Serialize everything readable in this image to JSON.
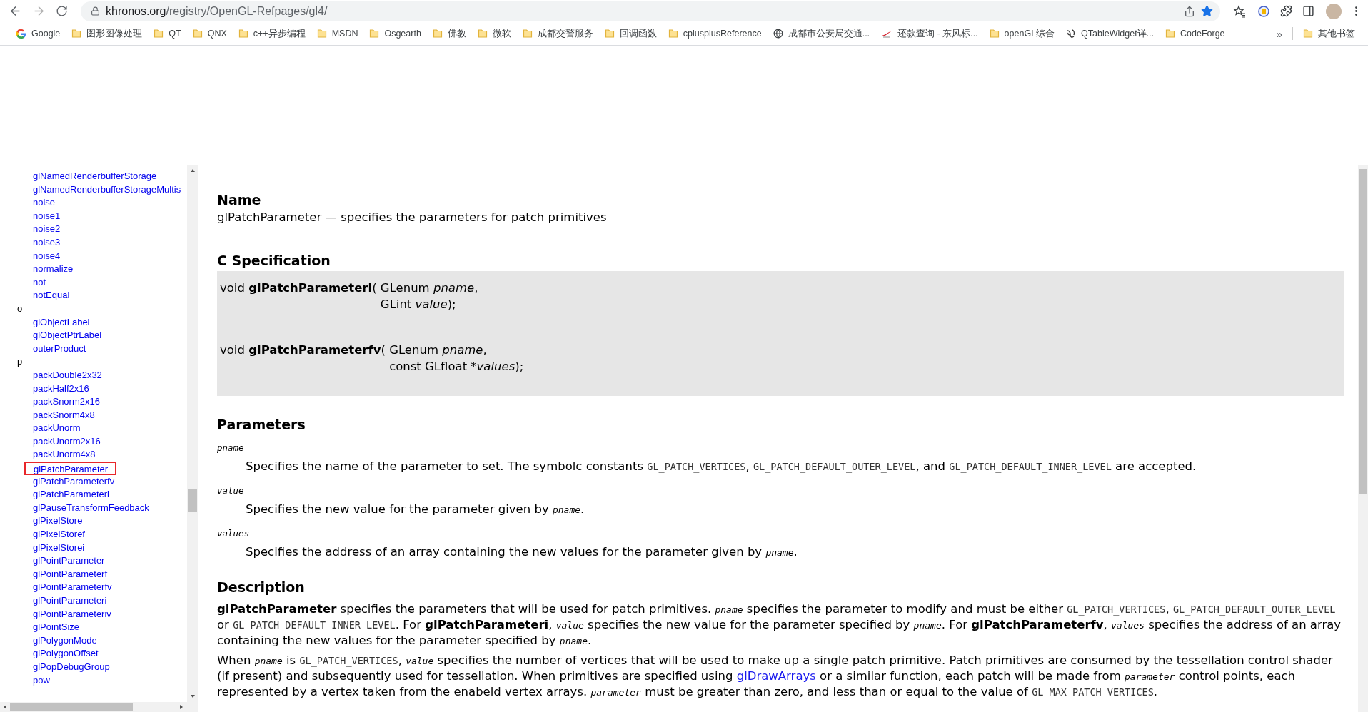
{
  "browser": {
    "url_host": "khronos.org",
    "url_path": "/registry/OpenGL-Refpages/gl4/",
    "bookmarked": true
  },
  "bookmarks": [
    {
      "label": "Google",
      "kind": "google"
    },
    {
      "label": "图形图像处理",
      "kind": "folder"
    },
    {
      "label": "QT",
      "kind": "folder"
    },
    {
      "label": "QNX",
      "kind": "folder"
    },
    {
      "label": "c++异步编程",
      "kind": "folder"
    },
    {
      "label": "MSDN",
      "kind": "folder"
    },
    {
      "label": "Osgearth",
      "kind": "folder"
    },
    {
      "label": "佛教",
      "kind": "folder"
    },
    {
      "label": "微软",
      "kind": "folder"
    },
    {
      "label": "成都交警服务",
      "kind": "folder"
    },
    {
      "label": "回调函数",
      "kind": "folder"
    },
    {
      "label": "cplusplusReference",
      "kind": "folder"
    },
    {
      "label": "成都市公安局交通...",
      "kind": "globe"
    },
    {
      "label": "还款查询 - 东风标...",
      "kind": "swoosh"
    },
    {
      "label": "openGL综合",
      "kind": "folder"
    },
    {
      "label": "QTableWidget详...",
      "kind": "script"
    },
    {
      "label": "CodeForge",
      "kind": "folder"
    }
  ],
  "bookmarks_overflow": "»",
  "other_bookmarks": {
    "label": "其他书签",
    "kind": "folder"
  },
  "sidebar": {
    "items": [
      {
        "kind": "link",
        "label": "glNamedRenderbufferStorage",
        "selected": false
      },
      {
        "kind": "link",
        "label": "glNamedRenderbufferStorageMultis",
        "selected": false
      },
      {
        "kind": "link",
        "label": "noise",
        "selected": false
      },
      {
        "kind": "link",
        "label": "noise1",
        "selected": false
      },
      {
        "kind": "link",
        "label": "noise2",
        "selected": false
      },
      {
        "kind": "link",
        "label": "noise3",
        "selected": false
      },
      {
        "kind": "link",
        "label": "noise4",
        "selected": false
      },
      {
        "kind": "link",
        "label": "normalize",
        "selected": false
      },
      {
        "kind": "link",
        "label": "not",
        "selected": false
      },
      {
        "kind": "link",
        "label": "notEqual",
        "selected": false
      },
      {
        "kind": "letter",
        "label": "o"
      },
      {
        "kind": "link",
        "label": "glObjectLabel",
        "selected": false
      },
      {
        "kind": "link",
        "label": "glObjectPtrLabel",
        "selected": false
      },
      {
        "kind": "link",
        "label": "outerProduct",
        "selected": false
      },
      {
        "kind": "letter",
        "label": "p"
      },
      {
        "kind": "link",
        "label": "packDouble2x32",
        "selected": false
      },
      {
        "kind": "link",
        "label": "packHalf2x16",
        "selected": false
      },
      {
        "kind": "link",
        "label": "packSnorm2x16",
        "selected": false
      },
      {
        "kind": "link",
        "label": "packSnorm4x8",
        "selected": false
      },
      {
        "kind": "link",
        "label": "packUnorm",
        "selected": false
      },
      {
        "kind": "link",
        "label": "packUnorm2x16",
        "selected": false
      },
      {
        "kind": "link",
        "label": "packUnorm4x8",
        "selected": false
      },
      {
        "kind": "link",
        "label": "glPatchParameter",
        "selected": true
      },
      {
        "kind": "link",
        "label": "glPatchParameterfv",
        "selected": false
      },
      {
        "kind": "link",
        "label": "glPatchParameteri",
        "selected": false
      },
      {
        "kind": "link",
        "label": "glPauseTransformFeedback",
        "selected": false
      },
      {
        "kind": "link",
        "label": "glPixelStore",
        "selected": false
      },
      {
        "kind": "link",
        "label": "glPixelStoref",
        "selected": false
      },
      {
        "kind": "link",
        "label": "glPixelStorei",
        "selected": false
      },
      {
        "kind": "link",
        "label": "glPointParameter",
        "selected": false
      },
      {
        "kind": "link",
        "label": "glPointParameterf",
        "selected": false
      },
      {
        "kind": "link",
        "label": "glPointParameterfv",
        "selected": false
      },
      {
        "kind": "link",
        "label": "glPointParameteri",
        "selected": false
      },
      {
        "kind": "link",
        "label": "glPointParameteriv",
        "selected": false
      },
      {
        "kind": "link",
        "label": "glPointSize",
        "selected": false
      },
      {
        "kind": "link",
        "label": "glPolygonMode",
        "selected": false
      },
      {
        "kind": "link",
        "label": "glPolygonOffset",
        "selected": false
      },
      {
        "kind": "link",
        "label": "glPopDebugGroup",
        "selected": false
      },
      {
        "kind": "link",
        "label": "pow",
        "selected": false
      }
    ]
  },
  "name_section": {
    "heading": "Name",
    "text": "glPatchParameter — specifies the parameters for patch primitives"
  },
  "c_specification": {
    "heading": "C Specification",
    "prototypes": [
      {
        "ret": "void ",
        "func": "glPatchParameteri",
        "open": "( ",
        "params": [
          {
            "type": "GLenum ",
            "name": "pname",
            "end": ","
          },
          {
            "type": "GLint ",
            "name": "value",
            "end": ");"
          }
        ]
      },
      {
        "ret": "void ",
        "func": "glPatchParameterfv",
        "open": "( ",
        "params": [
          {
            "type": "GLenum ",
            "name": "pname",
            "end": ","
          },
          {
            "type": "const GLfloat *",
            "name": "values",
            "end": ");"
          }
        ]
      }
    ]
  },
  "parameters": {
    "heading": "Parameters",
    "items": [
      {
        "name": "pname",
        "description": [
          {
            "kind": "text",
            "text": "Specifies the name of the parameter to set. The symbolc constants "
          },
          {
            "kind": "code",
            "text": "GL_PATCH_VERTICES"
          },
          {
            "kind": "text",
            "text": ", "
          },
          {
            "kind": "code",
            "text": "GL_PATCH_DEFAULT_OUTER_LEVEL"
          },
          {
            "kind": "text",
            "text": ", and "
          },
          {
            "kind": "code",
            "text": "GL_PATCH_DEFAULT_INNER_LEVEL"
          },
          {
            "kind": "text",
            "text": " are accepted."
          }
        ]
      },
      {
        "name": "value",
        "description": [
          {
            "kind": "text",
            "text": "Specifies the new value for the parameter given by "
          },
          {
            "kind": "param",
            "text": "pname"
          },
          {
            "kind": "text",
            "text": "."
          }
        ]
      },
      {
        "name": "values",
        "description": [
          {
            "kind": "text",
            "text": "Specifies the address of an array containing the new values for the parameter given by "
          },
          {
            "kind": "param",
            "text": "pname"
          },
          {
            "kind": "text",
            "text": "."
          }
        ]
      }
    ]
  },
  "description": {
    "heading": "Description",
    "paragraphs": [
      [
        {
          "kind": "bold",
          "text": "glPatchParameter"
        },
        {
          "kind": "text",
          "text": " specifies the parameters that will be used for patch primitives. "
        },
        {
          "kind": "param",
          "text": "pname"
        },
        {
          "kind": "text",
          "text": " specifies the parameter to modify and must be either "
        },
        {
          "kind": "code",
          "text": "GL_PATCH_VERTICES"
        },
        {
          "kind": "text",
          "text": ", "
        },
        {
          "kind": "code",
          "text": "GL_PATCH_DEFAULT_OUTER_LEVEL"
        },
        {
          "kind": "text",
          "text": " or "
        },
        {
          "kind": "code",
          "text": "GL_PATCH_DEFAULT_INNER_LEVEL"
        },
        {
          "kind": "text",
          "text": ". For "
        },
        {
          "kind": "bold",
          "text": "glPatchParameteri"
        },
        {
          "kind": "text",
          "text": ", "
        },
        {
          "kind": "param",
          "text": "value"
        },
        {
          "kind": "text",
          "text": " specifies the new value for the parameter specified by "
        },
        {
          "kind": "param",
          "text": "pname"
        },
        {
          "kind": "text",
          "text": ". For "
        },
        {
          "kind": "bold",
          "text": "glPatchParameterfv"
        },
        {
          "kind": "text",
          "text": ", "
        },
        {
          "kind": "param",
          "text": "values"
        },
        {
          "kind": "text",
          "text": " specifies the address of an array containing the new values for the parameter specified by "
        },
        {
          "kind": "param",
          "text": "pname"
        },
        {
          "kind": "text",
          "text": "."
        }
      ],
      [
        {
          "kind": "text",
          "text": "When "
        },
        {
          "kind": "param",
          "text": "pname"
        },
        {
          "kind": "text",
          "text": " is "
        },
        {
          "kind": "code",
          "text": "GL_PATCH_VERTICES"
        },
        {
          "kind": "text",
          "text": ", "
        },
        {
          "kind": "param",
          "text": "value"
        },
        {
          "kind": "text",
          "text": " specifies the number of vertices that will be used to make up a single patch primitive. Patch primitives are consumed by the tessellation control shader (if present) and subsequently used for tessellation. When primitives are specified using "
        },
        {
          "kind": "link",
          "text": "glDrawArrays"
        },
        {
          "kind": "text",
          "text": " or a similar function, each patch will be made from "
        },
        {
          "kind": "param",
          "text": "parameter"
        },
        {
          "kind": "text",
          "text": " control points, each represented by a vertex taken from the enabeld vertex arrays. "
        },
        {
          "kind": "param",
          "text": "parameter"
        },
        {
          "kind": "text",
          "text": " must be greater than zero, and less than or equal to the value of "
        },
        {
          "kind": "code",
          "text": "GL_MAX_PATCH_VERTICES"
        },
        {
          "kind": "text",
          "text": "."
        }
      ]
    ]
  }
}
